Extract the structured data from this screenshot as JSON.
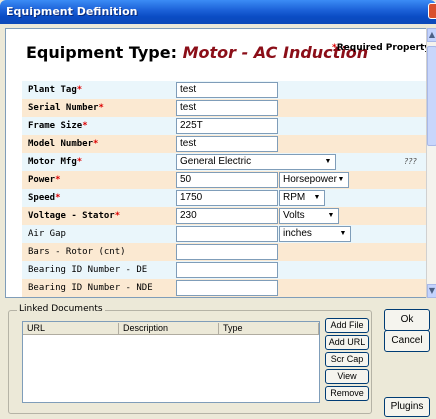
{
  "window": {
    "title": "Equipment Definition"
  },
  "header": {
    "prefix": "Equipment Type: ",
    "type": "Motor - AC Induction",
    "required_note": "Required Property",
    "required_star": "*"
  },
  "fields": [
    {
      "label": "Plant Tag",
      "required": "*",
      "value": "test"
    },
    {
      "label": "Serial Number",
      "required": "*",
      "value": "test"
    },
    {
      "label": "Frame Size",
      "required": "*",
      "value": "225T"
    },
    {
      "label": "Model Number",
      "required": "*",
      "value": "test"
    },
    {
      "label": "Motor Mfg",
      "required": "*",
      "value": "General Electric",
      "help": "???"
    },
    {
      "label": "Power",
      "required": "*",
      "value": "50",
      "unit": "Horsepower"
    },
    {
      "label": "Speed",
      "required": "*",
      "value": "1750",
      "unit": "RPM"
    },
    {
      "label": "Voltage - Stator",
      "required": "*",
      "value": "230",
      "unit": "Volts"
    },
    {
      "label": "Air Gap",
      "required": "",
      "value": "",
      "unit": "inches"
    },
    {
      "label": "Bars - Rotor (cnt)",
      "required": "",
      "value": ""
    },
    {
      "label": "Bearing ID Number - DE",
      "required": "",
      "value": ""
    },
    {
      "label": "Bearing ID Number - NDE",
      "required": "",
      "value": ""
    }
  ],
  "linked_documents": {
    "legend": "Linked Documents",
    "columns": [
      "URL",
      "Description",
      "Type"
    ]
  },
  "buttons": {
    "add_file": "Add File",
    "add_url": "Add URL",
    "scr_cap": "Scr Cap",
    "view": "View",
    "remove": "Remove",
    "ok": "Ok",
    "cancel": "Cancel",
    "plugins": "Plugins"
  }
}
